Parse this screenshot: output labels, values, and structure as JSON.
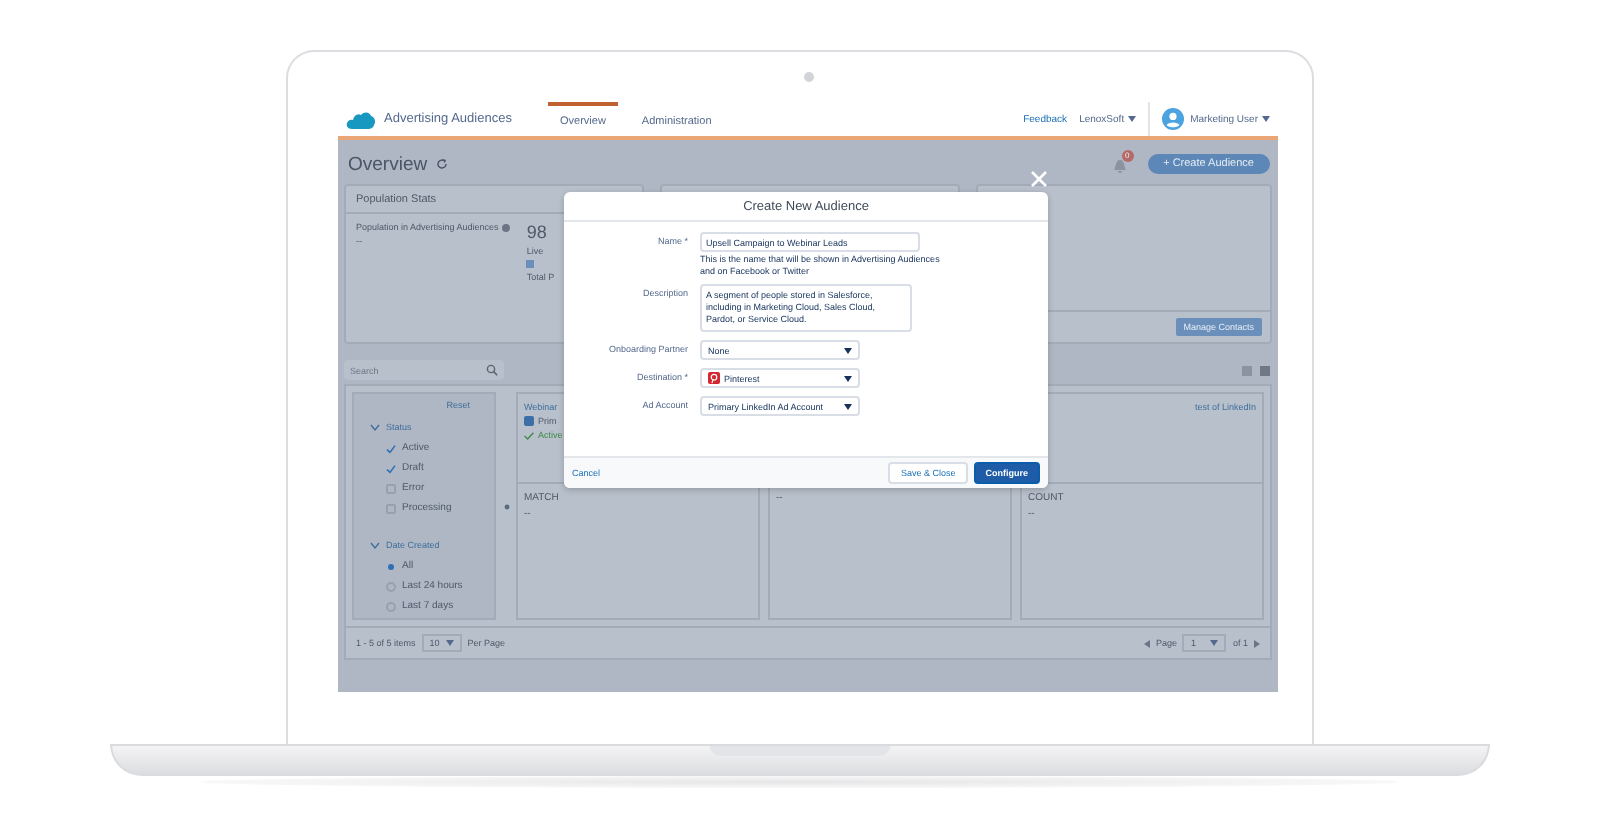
{
  "app": {
    "name": "Advertising Audiences"
  },
  "tabs": [
    {
      "label": "Overview",
      "selected": true
    },
    {
      "label": "Administration",
      "selected": false
    }
  ],
  "header_links": {
    "feedback": "Feedback",
    "org": "LenoxSoft",
    "user": "Marketing User"
  },
  "page": {
    "title": "Overview",
    "notifications": "0",
    "create_button": "+ Create Audience"
  },
  "population_stats": {
    "title": "Population Stats",
    "label": "Population in Advertising Audiences",
    "value": "--",
    "count": "98",
    "live": "Live",
    "total": "Total P"
  },
  "manage_button": "Manage Contacts",
  "search": {
    "placeholder": "Search"
  },
  "filters": {
    "reset": "Reset",
    "groups": [
      {
        "label": "Status",
        "expanded": true,
        "kind": "checkbox",
        "options": [
          {
            "label": "Active",
            "checked": true
          },
          {
            "label": "Draft",
            "checked": true
          },
          {
            "label": "Error",
            "checked": false
          },
          {
            "label": "Processing",
            "checked": false
          }
        ]
      },
      {
        "label": "Date Created",
        "expanded": true,
        "kind": "radio",
        "options": [
          {
            "label": "All",
            "selected": true
          },
          {
            "label": "Last 24 hours",
            "selected": false
          },
          {
            "label": "Last 7 days",
            "selected": false
          }
        ]
      }
    ]
  },
  "cards": [
    {
      "title": "Webinar",
      "destination": "Prim",
      "status": "Active",
      "metric": "MATCH",
      "value": "--"
    },
    {
      "value": "--"
    },
    {
      "title": "test of LinkedIn",
      "metric": "COUNT",
      "value": "--"
    }
  ],
  "pagination": {
    "range": "1 - 5 of 5 items",
    "per_page": "10",
    "per_page_label": "Per Page",
    "page_label": "Page",
    "page": "1",
    "of": "of 1"
  },
  "modal": {
    "title": "Create New Audience",
    "fields": [
      {
        "label": "Name *",
        "kind": "text",
        "value": "Upsell Campaign to Webinar Leads",
        "help": "This is the name that will be shown in Advertising Audiences and on Facebook or Twitter"
      },
      {
        "label": "Description",
        "kind": "textarea",
        "value": "A segment of people stored in Salesforce, including in Marketing Cloud, Sales Cloud, Pardot, or Service Cloud."
      },
      {
        "label": "Onboarding Partner",
        "kind": "select",
        "value": "None"
      },
      {
        "label": "Destination *",
        "kind": "select",
        "value": "Pinterest",
        "logo": true
      },
      {
        "label": "Ad Account",
        "kind": "select",
        "value": "Primary LinkedIn Ad Account"
      }
    ],
    "cancel": "Cancel",
    "save": "Save & Close",
    "configure": "Configure"
  }
}
